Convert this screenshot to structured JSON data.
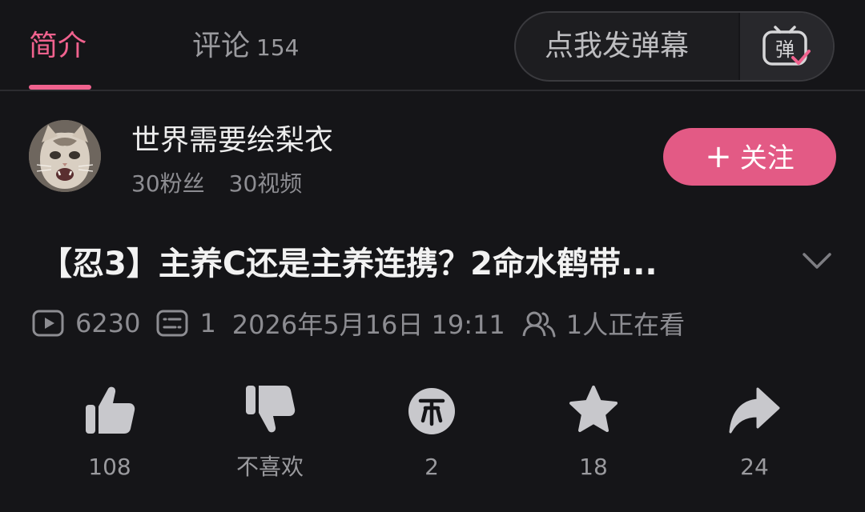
{
  "tabs": {
    "intro": "简介",
    "comments": "评论",
    "comments_count": "154"
  },
  "danmaku": {
    "placeholder": "点我发弹幕",
    "toggle_icon": "danmaku-toggle-icon",
    "toggle_glyph": "弹"
  },
  "uploader": {
    "name": "世界需要绘梨衣",
    "fans": "30粉丝",
    "videos": "30视频",
    "follow_plus": "+",
    "follow_label": "关注"
  },
  "video": {
    "title": "【忍3】主养C还是主养连携？2命水鹤带...",
    "play_count": "6230",
    "danmaku_count": "1",
    "publish_time": "2026年5月16日 19:11",
    "watching": "1人正在看"
  },
  "actions": {
    "like": "108",
    "dislike": "不喜欢",
    "coin": "2",
    "favorite": "18",
    "share": "24"
  },
  "colors": {
    "accent": "#f0628e",
    "follow_bg": "#e35a85",
    "background": "#151518",
    "muted_text": "#8d8d92"
  }
}
